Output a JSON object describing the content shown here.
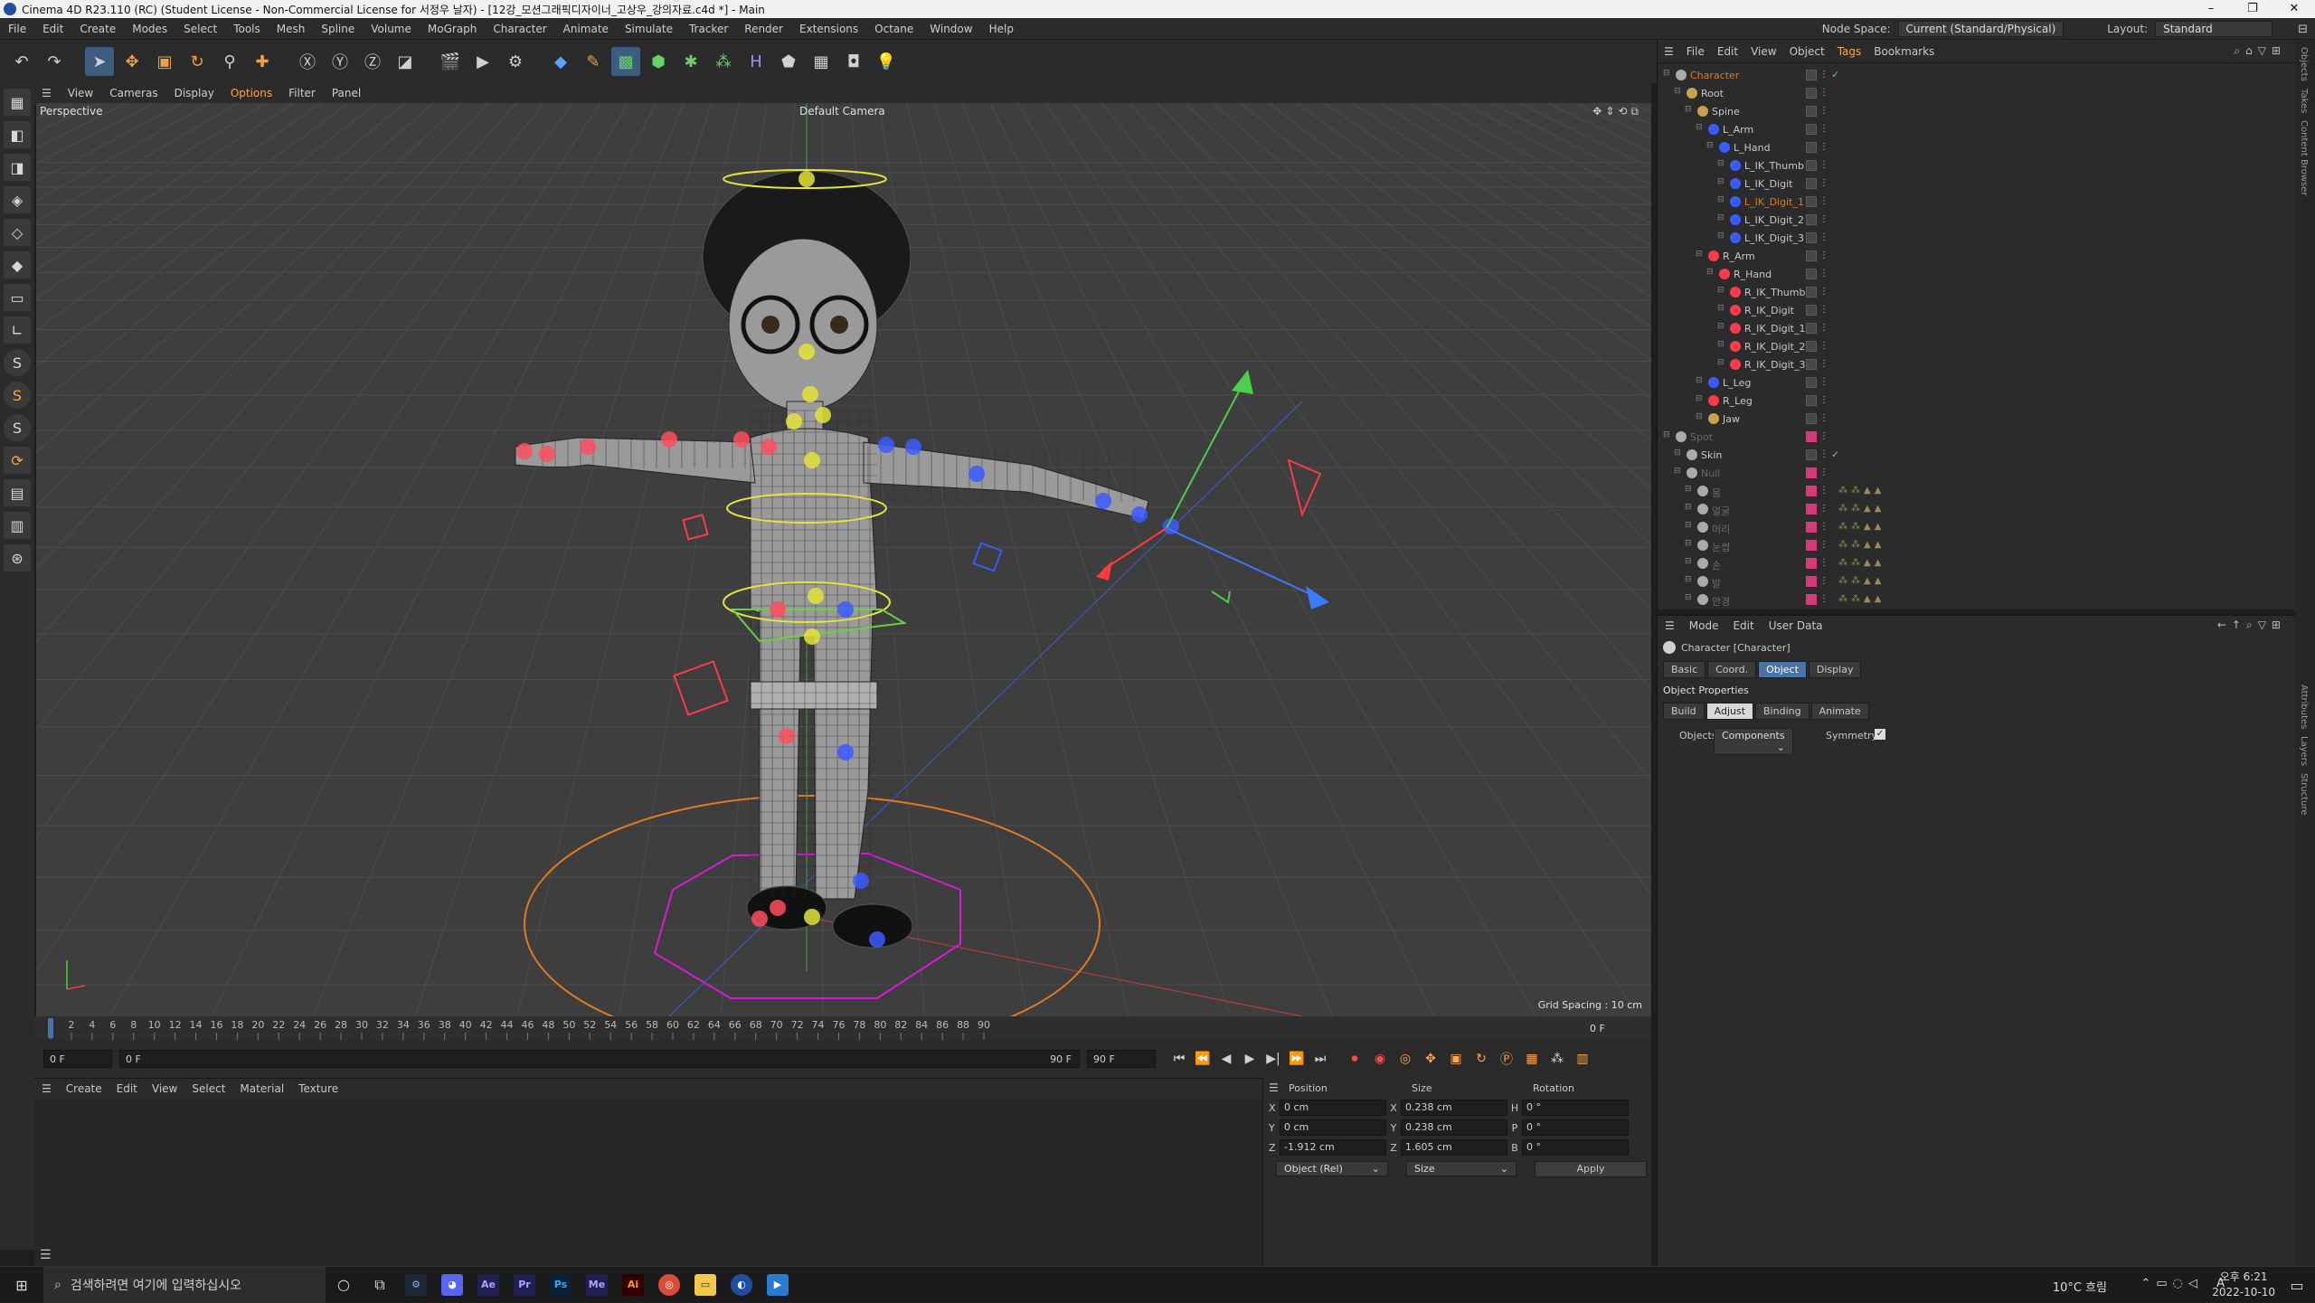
{
  "window": {
    "title": "Cinema 4D R23.110 (RC) (Student License - Non-Commercial License for 서정우 날자) - [12강_모션그래픽디자이너_고상우_강의자료.c4d *] - Main",
    "controls": [
      "–",
      "❐",
      "✕"
    ]
  },
  "menubar": {
    "items": [
      "File",
      "Edit",
      "Create",
      "Modes",
      "Select",
      "Tools",
      "Mesh",
      "Spline",
      "Volume",
      "MoGraph",
      "Character",
      "Animate",
      "Simulate",
      "Tracker",
      "Render",
      "Extensions",
      "Octane",
      "Window",
      "Help"
    ],
    "node_space_label": "Node Space:",
    "node_space_value": "Current (Standard/Physical)",
    "layout_label": "Layout:",
    "layout_value": "Standard"
  },
  "toolbar": {
    "icons": [
      "undo-icon",
      "redo-icon",
      "select-icon",
      "move-icon",
      "scale-icon",
      "rotate-icon",
      "select-tool-icon",
      "add-icon",
      "x-axis-icon",
      "y-axis-icon",
      "z-axis-icon",
      "coord-system-icon",
      "render-region-icon",
      "render-view-icon",
      "render-settings-icon",
      "cube-icon",
      "pen-icon",
      "subdivision-icon",
      "extrude-icon",
      "cloner-icon",
      "mograph-icon",
      "deformer-icon",
      "scene-icon",
      "floor-icon",
      "camera-icon",
      "light-icon"
    ]
  },
  "viewport": {
    "menu": [
      "View",
      "Cameras",
      "Display",
      "Options",
      "Filter",
      "Panel"
    ],
    "label": "Perspective",
    "camera": "Default Camera",
    "grid_spacing": "Grid Spacing : 10 cm",
    "colors": {
      "bg": "#3e3e3e",
      "grid": "#4c4c4c",
      "mesh": "#cfcfcf",
      "left": "#ff4d5e",
      "right": "#3a5bff",
      "center": "#e4e43a",
      "ground": "#e07a20",
      "hex": "#d81bd8"
    }
  },
  "timeline": {
    "ticks": [
      "0",
      "2",
      "4",
      "6",
      "8",
      "10",
      "12",
      "14",
      "16",
      "18",
      "20",
      "22",
      "24",
      "26",
      "28",
      "30",
      "32",
      "34",
      "36",
      "38",
      "40",
      "42",
      "44",
      "46",
      "48",
      "50",
      "52",
      "54",
      "56",
      "58",
      "60",
      "62",
      "64",
      "66",
      "68",
      "70",
      "72",
      "74",
      "76",
      "78",
      "80",
      "82",
      "84",
      "86",
      "88",
      "90"
    ],
    "current_frame": "0 F",
    "start_field": "0 F",
    "range_start": "0 F",
    "range_end": "90 F",
    "end_field": "90 F"
  },
  "material": {
    "menu": [
      "Create",
      "Edit",
      "View",
      "Select",
      "Material",
      "Texture"
    ]
  },
  "coords": {
    "headers": [
      "Position",
      "Size",
      "Rotation"
    ],
    "rows": [
      {
        "axis": "X",
        "pos": "0 cm",
        "size_axis": "X",
        "size": "0.238 cm",
        "rot_axis": "H",
        "rot": "0 °"
      },
      {
        "axis": "Y",
        "pos": "0 cm",
        "size_axis": "Y",
        "size": "0.238 cm",
        "rot_axis": "P",
        "rot": "0 °"
      },
      {
        "axis": "Z",
        "pos": "-1.912 cm",
        "size_axis": "Z",
        "size": "1.605 cm",
        "rot_axis": "B",
        "rot": "0 °"
      }
    ],
    "mode": "Object (Rel)",
    "size_mode": "Size",
    "apply": "Apply"
  },
  "objects": {
    "menu": [
      "File",
      "Edit",
      "View",
      "Object",
      "Tags",
      "Bookmarks"
    ],
    "items": [
      {
        "name": "Character",
        "indent": 0,
        "color": "#e07a20",
        "icon": "character-icon"
      },
      {
        "name": "Root",
        "indent": 1,
        "color": "#c8c8c8",
        "icon": "joint-icon"
      },
      {
        "name": "Spine",
        "indent": 2,
        "color": "#c8c8c8",
        "icon": "joint-icon"
      },
      {
        "name": "L_Arm",
        "indent": 3,
        "color": "#c8c8c8",
        "icon": "joint-icon"
      },
      {
        "name": "L_Hand",
        "indent": 4,
        "color": "#c8c8c8",
        "icon": "joint-icon"
      },
      {
        "name": "L_IK_Thumb",
        "indent": 5,
        "color": "#c8c8c8",
        "icon": "joint-icon"
      },
      {
        "name": "L_IK_Digit",
        "indent": 5,
        "color": "#c8c8c8",
        "icon": "joint-icon"
      },
      {
        "name": "L_IK_Digit_1",
        "indent": 5,
        "color": "#e07a20",
        "icon": "joint-icon"
      },
      {
        "name": "L_IK_Digit_2",
        "indent": 5,
        "color": "#c8c8c8",
        "icon": "joint-icon"
      },
      {
        "name": "L_IK_Digit_3",
        "indent": 5,
        "color": "#c8c8c8",
        "icon": "joint-icon"
      },
      {
        "name": "R_Arm",
        "indent": 3,
        "color": "#c8c8c8",
        "icon": "joint-icon"
      },
      {
        "name": "R_Hand",
        "indent": 4,
        "color": "#c8c8c8",
        "icon": "joint-icon"
      },
      {
        "name": "R_IK_Thumb",
        "indent": 5,
        "color": "#c8c8c8",
        "icon": "joint-icon"
      },
      {
        "name": "R_IK_Digit",
        "indent": 5,
        "color": "#c8c8c8",
        "icon": "joint-icon"
      },
      {
        "name": "R_IK_Digit_1",
        "indent": 5,
        "color": "#c8c8c8",
        "icon": "joint-icon"
      },
      {
        "name": "R_IK_Digit_2",
        "indent": 5,
        "color": "#c8c8c8",
        "icon": "joint-icon"
      },
      {
        "name": "R_IK_Digit_3",
        "indent": 5,
        "color": "#c8c8c8",
        "icon": "joint-icon"
      },
      {
        "name": "L_Leg",
        "indent": 3,
        "color": "#c8c8c8",
        "icon": "joint-icon"
      },
      {
        "name": "R_Leg",
        "indent": 3,
        "color": "#c8c8c8",
        "icon": "joint-icon"
      },
      {
        "name": "Jaw",
        "indent": 3,
        "color": "#c8c8c8",
        "icon": "joint-icon"
      },
      {
        "name": "Spot",
        "indent": 0,
        "color": "#6a6a6a",
        "icon": "null-icon"
      },
      {
        "name": "Skin",
        "indent": 1,
        "color": "#c8c8c8",
        "icon": "skin-icon"
      },
      {
        "name": "Null",
        "indent": 1,
        "color": "#6a6a6a",
        "icon": "null-icon"
      },
      {
        "name": "몸",
        "indent": 2,
        "color": "#6a6a6a",
        "icon": "mesh-icon"
      },
      {
        "name": "얼굴",
        "indent": 2,
        "color": "#6a6a6a",
        "icon": "mesh-icon"
      },
      {
        "name": "머리",
        "indent": 2,
        "color": "#6a6a6a",
        "icon": "mesh-icon"
      },
      {
        "name": "눈썹",
        "indent": 2,
        "color": "#6a6a6a",
        "icon": "mesh-icon"
      },
      {
        "name": "손",
        "indent": 2,
        "color": "#6a6a6a",
        "icon": "mesh-icon"
      },
      {
        "name": "발",
        "indent": 2,
        "color": "#6a6a6a",
        "icon": "mesh-icon"
      },
      {
        "name": "안경",
        "indent": 2,
        "color": "#6a6a6a",
        "icon": "mesh-icon"
      }
    ]
  },
  "attributes": {
    "menu": [
      "Mode",
      "Edit",
      "User Data"
    ],
    "object_title": "Character [Character]",
    "tabs": [
      "Basic",
      "Coord.",
      "Object",
      "Display"
    ],
    "active_tab": "Object",
    "section": "Object Properties",
    "subtabs": [
      "Build",
      "Adjust",
      "Binding",
      "Animate"
    ],
    "active_subtab": "Adjust",
    "objects_label": "Objects",
    "objects_value": "Components",
    "symmetry_label": "Symmetry"
  },
  "sidetabs": [
    "Objects",
    "Takes",
    "Content Browser",
    "Attributes",
    "Layers",
    "Structure"
  ],
  "taskbar": {
    "search_placeholder": "검색하려면 여기에 입력하십시오",
    "weather": "10°C 흐림",
    "time": "오후 6:21",
    "date": "2022-10-10",
    "lang": "A"
  }
}
